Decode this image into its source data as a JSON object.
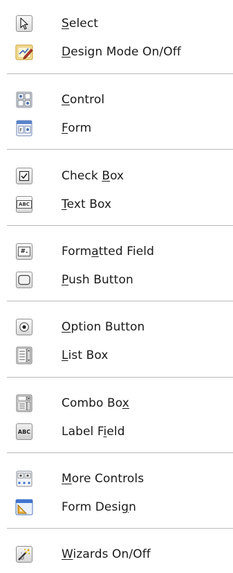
{
  "toolbar": {
    "items": [
      {
        "id": "select",
        "pre": "",
        "key": "S",
        "post": "elect",
        "icon": "cursor-arrow-icon"
      },
      {
        "id": "design-mode",
        "pre": "",
        "key": "D",
        "post": "esign Mode On/Off",
        "icon": "design-mode-icon"
      },
      {
        "id": "control",
        "pre": "",
        "key": "C",
        "post": "ontrol",
        "icon": "control-properties-icon"
      },
      {
        "id": "form",
        "pre": "",
        "key": "F",
        "post": "orm",
        "icon": "form-properties-icon"
      },
      {
        "id": "check-box",
        "pre": "Check ",
        "key": "B",
        "post": "ox",
        "icon": "checkbox-icon"
      },
      {
        "id": "text-box",
        "pre": "",
        "key": "T",
        "post": "ext Box",
        "icon": "text-box-icon"
      },
      {
        "id": "formatted-field",
        "pre": "Form",
        "key": "a",
        "post": "tted Field",
        "icon": "formatted-field-icon"
      },
      {
        "id": "push-button",
        "pre": "",
        "key": "P",
        "post": "ush Button",
        "icon": "push-button-icon"
      },
      {
        "id": "option-button",
        "pre": "",
        "key": "O",
        "post": "ption Button",
        "icon": "option-button-icon"
      },
      {
        "id": "list-box",
        "pre": "",
        "key": "L",
        "post": "ist Box",
        "icon": "list-box-icon"
      },
      {
        "id": "combo-box",
        "pre": "Combo Bo",
        "key": "x",
        "post": "",
        "icon": "combo-box-icon"
      },
      {
        "id": "label-field",
        "pre": "Label F",
        "key": "i",
        "post": "eld",
        "icon": "label-field-icon"
      },
      {
        "id": "more-controls",
        "pre": "",
        "key": "M",
        "post": "ore Controls",
        "icon": "more-controls-icon"
      },
      {
        "id": "form-design",
        "pre": "Form Desi",
        "key": "g",
        "post": "n",
        "icon": "form-design-icon"
      },
      {
        "id": "wizards",
        "pre": "",
        "key": "W",
        "post": "izards On/Off",
        "icon": "wizard-wand-icon"
      }
    ],
    "icon_text": {
      "text_box": "ABC",
      "label_field": "ABC",
      "formatted_field": "#."
    }
  }
}
